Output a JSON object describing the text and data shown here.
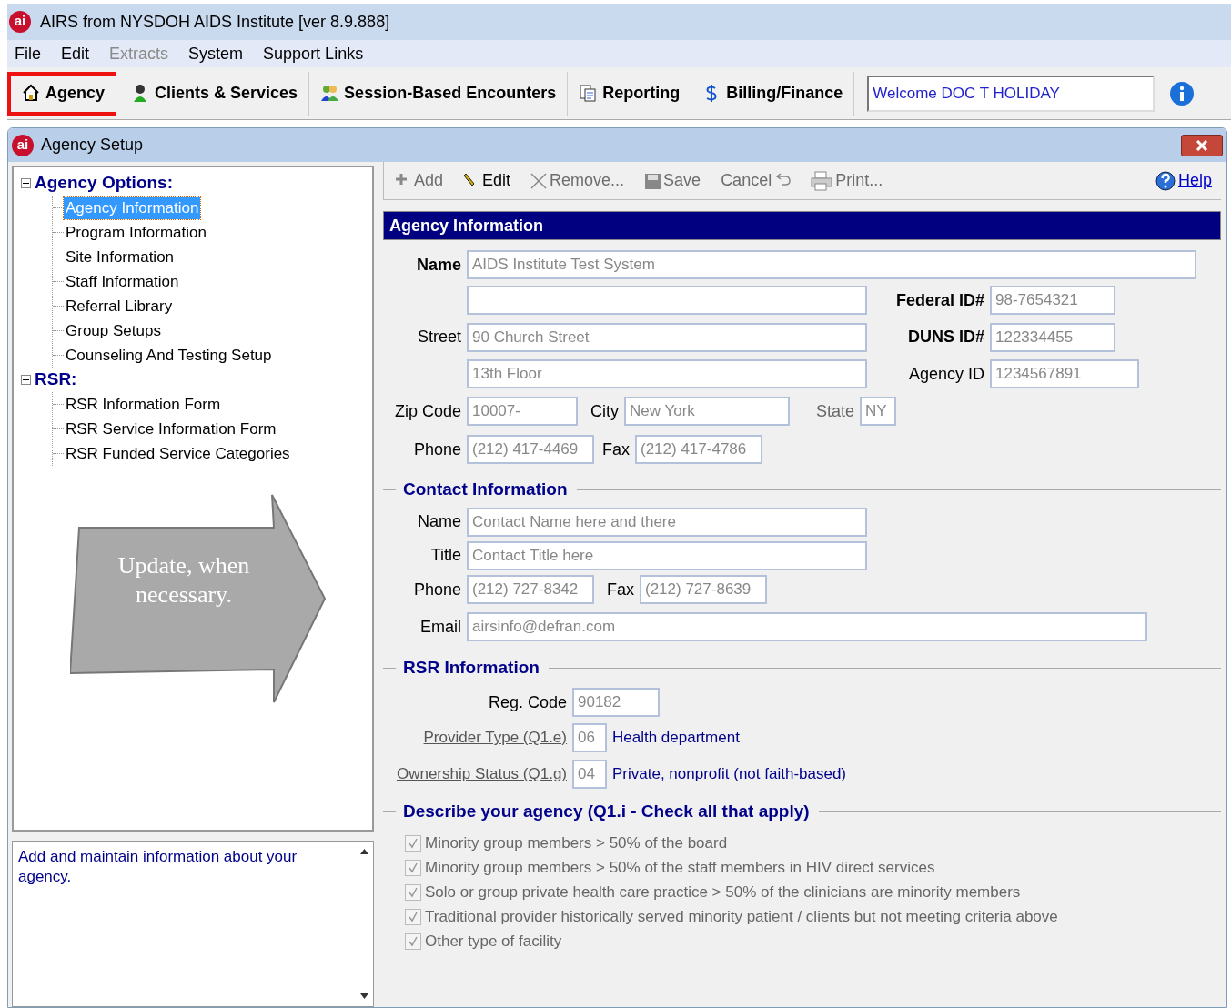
{
  "app": {
    "logo": "ai",
    "title": "AIRS from NYSDOH AIDS Institute [ver 8.9.888]"
  },
  "menu": [
    {
      "label": "File",
      "disabled": false
    },
    {
      "label": "Edit",
      "disabled": false
    },
    {
      "label": "Extracts",
      "disabled": true
    },
    {
      "label": "System",
      "disabled": false
    },
    {
      "label": "Support Links",
      "disabled": false
    }
  ],
  "nav": [
    {
      "label": "Agency",
      "highlighted": true
    },
    {
      "label": "Clients & Services",
      "highlighted": false
    },
    {
      "label": "Session-Based Encounters",
      "highlighted": false
    },
    {
      "label": "Reporting",
      "highlighted": false
    },
    {
      "label": "Billing/Finance",
      "highlighted": false
    }
  ],
  "welcome": "Welcome DOC T HOLIDAY",
  "window": {
    "logo": "ai",
    "title": "Agency Setup"
  },
  "tree": [
    {
      "label": "Agency Options:",
      "expanded": true,
      "children": [
        {
          "label": "Agency Information",
          "selected": true
        },
        {
          "label": "Program Information",
          "selected": false
        },
        {
          "label": "Site Information",
          "selected": false
        },
        {
          "label": "Staff Information",
          "selected": false
        },
        {
          "label": "Referral Library",
          "selected": false
        },
        {
          "label": "Group Setups",
          "selected": false
        },
        {
          "label": "Counseling And Testing Setup",
          "selected": false
        }
      ]
    },
    {
      "label": "RSR:",
      "expanded": true,
      "children": [
        {
          "label": "RSR Information Form",
          "selected": false
        },
        {
          "label": "RSR Service Information Form",
          "selected": false
        },
        {
          "label": "RSR Funded Service Categories",
          "selected": false
        }
      ]
    }
  ],
  "annotation": {
    "text": "Update, when necessary."
  },
  "hint": "Add and maintain information about your agency.",
  "toolbar": [
    {
      "label": "Add",
      "disabled": true
    },
    {
      "label": "Edit",
      "disabled": false
    },
    {
      "label": "Remove...",
      "disabled": true
    },
    {
      "label": "Save",
      "disabled": true
    },
    {
      "label": "Cancel",
      "disabled": true
    },
    {
      "label": "Print...",
      "disabled": true
    }
  ],
  "help": "Help",
  "section_title": "Agency Information",
  "agency": {
    "name_label": "Name",
    "name": "AIDS Institute Test System",
    "federal_label": "Federal ID#",
    "federal_id": "98-7654321",
    "street_label": "Street",
    "street": "90 Church Street",
    "duns_label": "DUNS ID#",
    "duns_id": "122334455",
    "street2": "13th Floor",
    "agency_id_label": "Agency ID",
    "agency_id": "1234567891",
    "zip_label": "Zip Code",
    "zip": "10007-",
    "city_label": "City",
    "city": "New York",
    "state_label": "State",
    "state": "NY",
    "phone_label": "Phone",
    "phone": "(212) 417-4469",
    "fax_label": "Fax",
    "fax": "(212) 417-4786"
  },
  "contact": {
    "title": "Contact Information",
    "name_label": "Name",
    "name": "Contact Name here and there",
    "title_label": "Title",
    "contact_title": "Contact Title here",
    "phone_label": "Phone",
    "phone": "(212) 727-8342",
    "fax_label": "Fax",
    "fax": "(212) 727-8639",
    "email_label": "Email",
    "email": "airsinfo@defran.com"
  },
  "rsr": {
    "title": "RSR Information",
    "reg_label": "Reg. Code",
    "reg_code": "90182",
    "provider_label": "Provider Type (Q1.e)",
    "provider_code": "06",
    "provider_text": "Health department",
    "ownership_label": "Ownership Status (Q1.g)",
    "ownership_code": "04",
    "ownership_text": "Private, nonprofit (not faith-based)"
  },
  "describe": {
    "title": "Describe your agency (Q1.i - Check all that apply)",
    "options": [
      {
        "label": "Minority group members > 50% of the board",
        "checked": true
      },
      {
        "label": "Minority group members > 50% of the staff members in HIV direct services",
        "checked": true
      },
      {
        "label": "Solo or group private health care practice > 50% of the clinicians are minority members",
        "checked": true
      },
      {
        "label": "Traditional provider historically served minority patient / clients but not meeting criteria above",
        "checked": true
      },
      {
        "label": "Other type of facility",
        "checked": true
      }
    ]
  }
}
